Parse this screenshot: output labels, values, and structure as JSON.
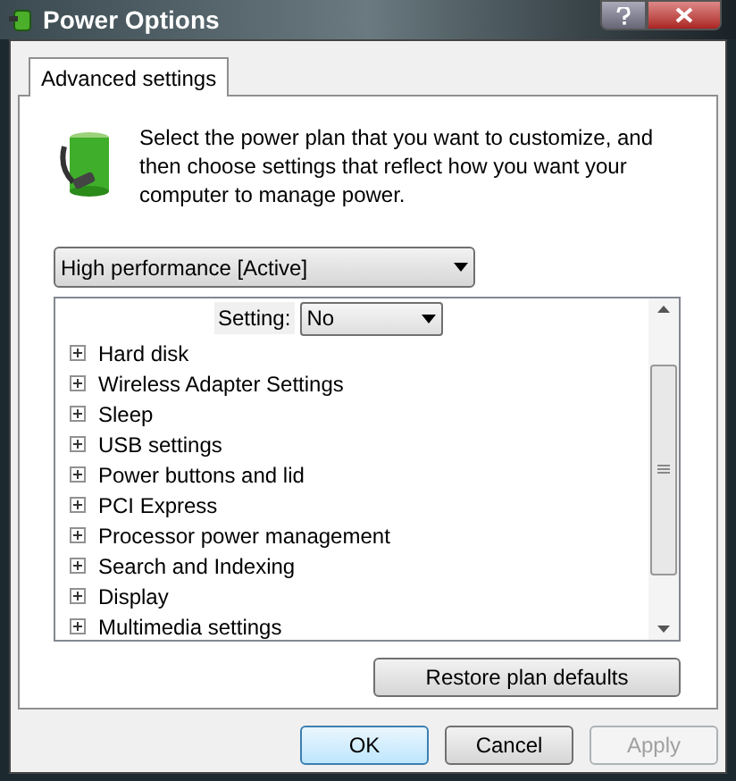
{
  "window": {
    "title": "Power Options"
  },
  "tabs": [
    {
      "label": "Advanced settings",
      "selected": true
    }
  ],
  "description": "Select the power plan that you want to customize, and then choose settings that reflect how you want your computer to manage power.",
  "plan_dropdown": {
    "value": "High performance [Active]"
  },
  "settings_tree": {
    "setting_label": "Setting:",
    "setting_value": "No",
    "items": [
      {
        "label": "Hard disk",
        "expanded": false
      },
      {
        "label": "Wireless Adapter Settings",
        "expanded": false
      },
      {
        "label": "Sleep",
        "expanded": false
      },
      {
        "label": "USB settings",
        "expanded": false
      },
      {
        "label": "Power buttons and lid",
        "expanded": false
      },
      {
        "label": "PCI Express",
        "expanded": false
      },
      {
        "label": "Processor power management",
        "expanded": false
      },
      {
        "label": "Search and Indexing",
        "expanded": false
      },
      {
        "label": "Display",
        "expanded": false
      },
      {
        "label": "Multimedia settings",
        "expanded": false
      }
    ]
  },
  "restore_button": "Restore plan defaults",
  "buttons": [
    {
      "label": "OK",
      "default": true,
      "disabled": false
    },
    {
      "label": "Cancel",
      "default": false,
      "disabled": false
    },
    {
      "label": "Apply",
      "default": false,
      "disabled": true
    }
  ]
}
